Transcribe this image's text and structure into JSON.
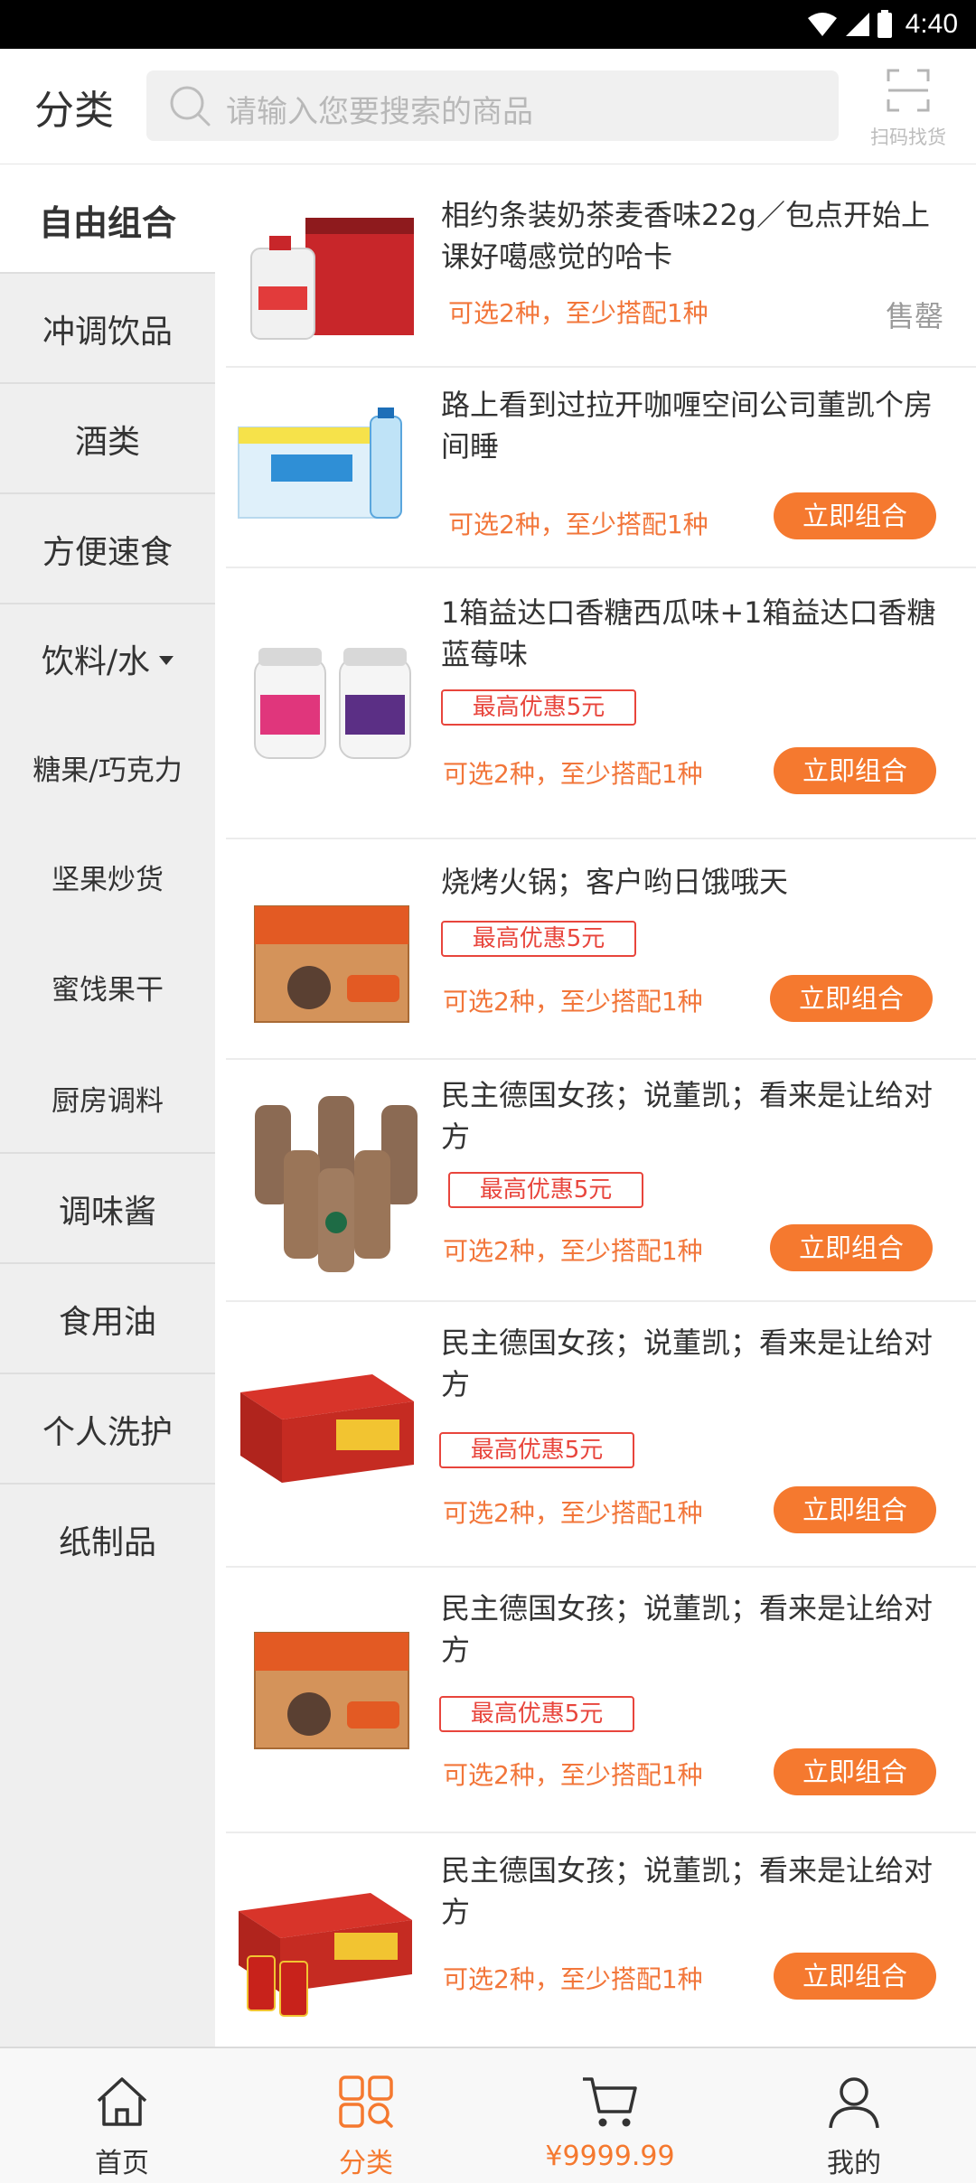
{
  "status_bar": {
    "time": "4:40"
  },
  "header": {
    "title": "分类",
    "search_placeholder": "请输入您要搜索的商品",
    "scan_label": "扫码找货"
  },
  "sidebar": {
    "items": [
      {
        "label": "自由组合"
      },
      {
        "label": "冲调饮品"
      },
      {
        "label": "酒类"
      },
      {
        "label": "方便速食"
      },
      {
        "label": "饮料/水"
      },
      {
        "label": "糖果/巧克力"
      },
      {
        "label": "坚果炒货"
      },
      {
        "label": "蜜饯果干"
      },
      {
        "label": "厨房调料"
      },
      {
        "label": "调味酱"
      },
      {
        "label": "食用油"
      },
      {
        "label": "个人洗护"
      },
      {
        "label": "纸制品"
      }
    ]
  },
  "products": [
    {
      "title": "相约条装奶茶麦香味22g／包点开始上课好噶感觉的哈卡",
      "rule": "可选2种，至少搭配1种",
      "status": "售罄",
      "image": "water-jug-box"
    },
    {
      "title": "路上看到过拉开咖喱空间公司董凯个房间睡",
      "rule": "可选2种，至少搭配1种",
      "button": "立即组合",
      "image": "water-bottle-box"
    },
    {
      "title": "1箱益达口香糖西瓜味+1箱益达口香糖蓝莓味",
      "promo": "最高优惠5元",
      "rule": "可选2种，至少搭配1种",
      "button": "立即组合",
      "image": "gum-bottles"
    },
    {
      "title": "烧烤火锅；客户哟日饿哦天",
      "promo": "最高优惠5元",
      "rule": "可选2种，至少搭配1种",
      "button": "立即组合",
      "image": "noodle-box"
    },
    {
      "title": "民主德国女孩；说董凯；看来是让给对方",
      "promo": "最高优惠5元",
      "rule": "可选2种，至少搭配1种",
      "button": "立即组合",
      "image": "coffee-bottles"
    },
    {
      "title": "民主德国女孩；说董凯；看来是让给对方",
      "promo": "最高优惠5元",
      "rule": "可选2种，至少搭配1种",
      "button": "立即组合",
      "image": "red-tea-box"
    },
    {
      "title": "民主德国女孩；说董凯；看来是让给对方",
      "promo": "最高优惠5元",
      "rule": "可选2种，至少搭配1种",
      "button": "立即组合",
      "image": "noodle-box"
    },
    {
      "title": "民主德国女孩；说董凯；看来是让给对方",
      "rule": "可选2种，至少搭配1种",
      "button": "立即组合",
      "image": "red-tea-box-cans"
    }
  ],
  "bottom_nav": {
    "items": [
      {
        "label": "首页",
        "icon": "home-icon"
      },
      {
        "label": "分类",
        "icon": "category-icon"
      },
      {
        "label": "¥9999.99",
        "icon": "cart-icon"
      },
      {
        "label": "我的",
        "icon": "profile-icon"
      }
    ]
  },
  "colors": {
    "accent": "#f5792f",
    "promo_red": "#e8453c",
    "sidebar_bg": "#efefef"
  }
}
